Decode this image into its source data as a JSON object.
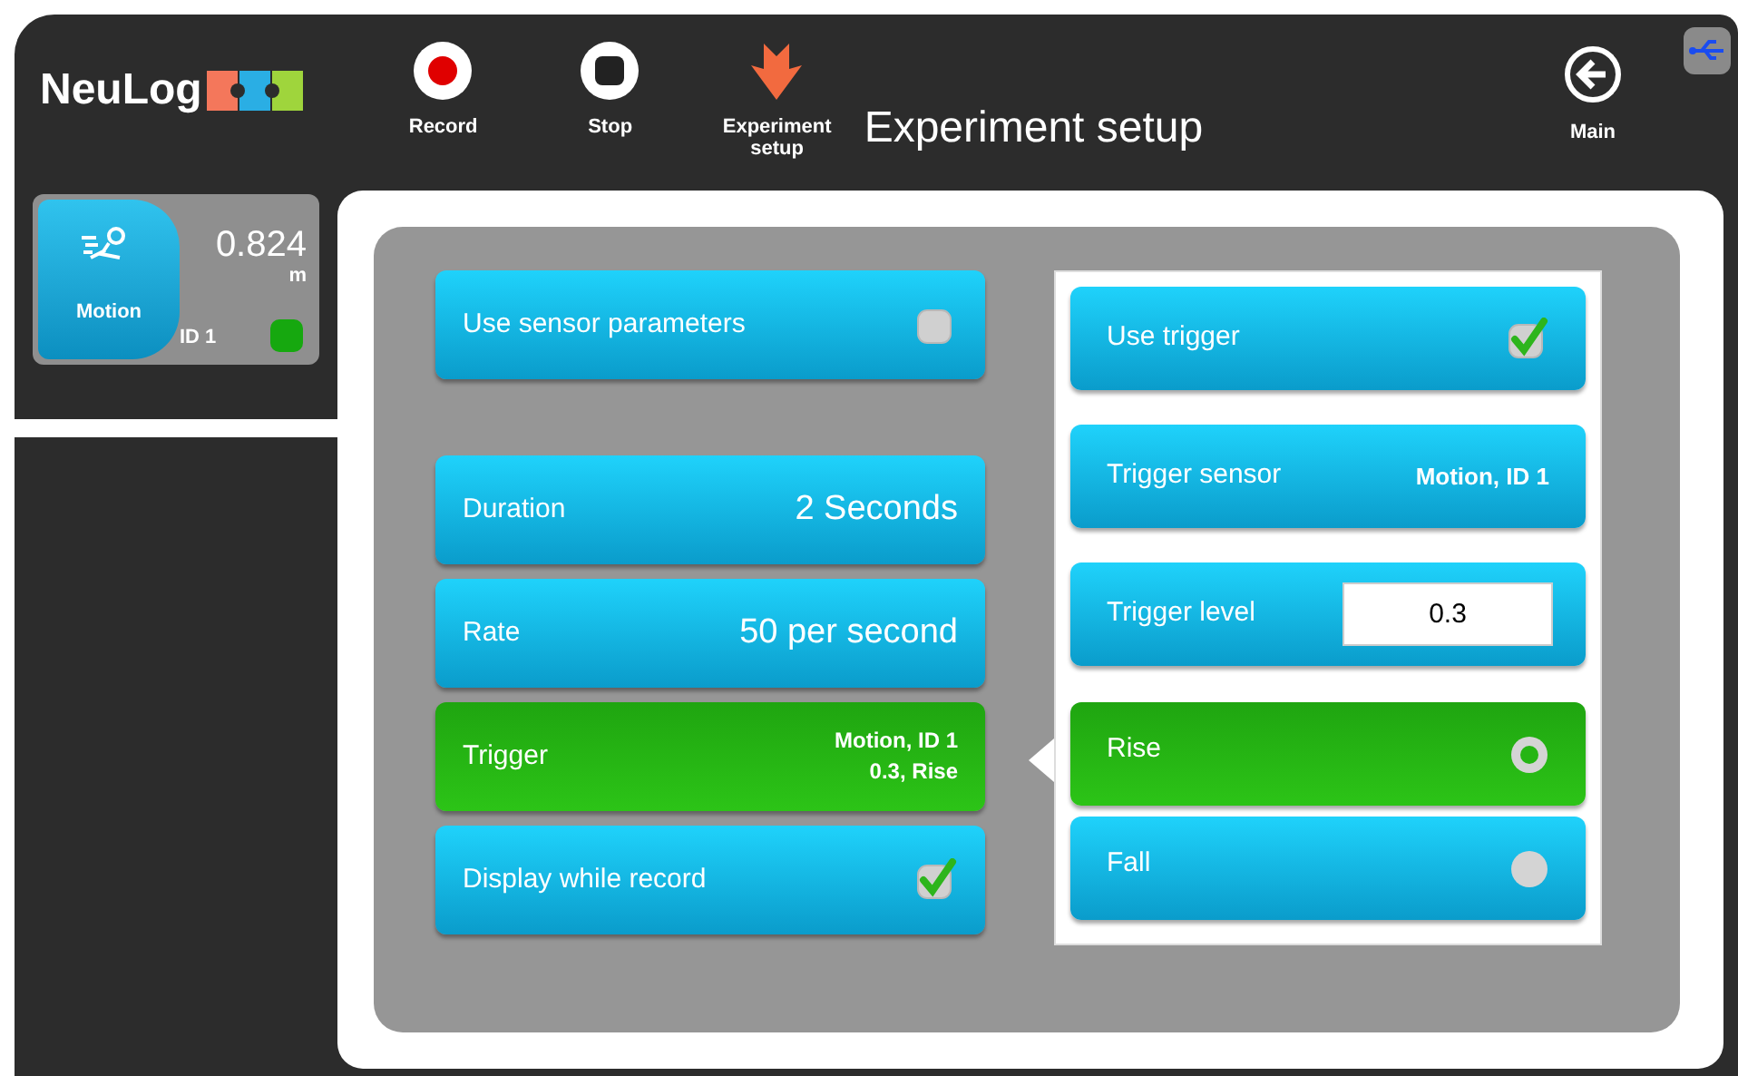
{
  "header": {
    "logo": "NeuLog",
    "tools": [
      {
        "kind": "record",
        "label": "Record"
      },
      {
        "kind": "stop",
        "label": "Stop"
      },
      {
        "kind": "setup",
        "label": "Experiment setup"
      }
    ],
    "title": "Experiment setup",
    "main": "Main"
  },
  "sensor": {
    "name": "Motion",
    "value": "0.824",
    "unit": "m",
    "id": "ID 1",
    "on": true
  },
  "sensor_parameters": {
    "label": "Use sensor parameters",
    "checked": false
  },
  "settings": [
    {
      "kind": "value",
      "label": "Duration",
      "value": "2 Seconds",
      "selected": false
    },
    {
      "kind": "value",
      "label": "Rate",
      "value": "50 per second",
      "selected": false
    },
    {
      "kind": "lines",
      "label": "Trigger",
      "lines": [
        "Motion, ID 1",
        "0.3, Rise"
      ],
      "selected": true
    },
    {
      "kind": "checkbox",
      "label": "Display while record",
      "checked": true,
      "selected": false
    }
  ],
  "trigger": [
    {
      "kind": "checkbox",
      "label": "Use trigger",
      "checked": true
    },
    {
      "kind": "value",
      "label": "Trigger sensor",
      "value": "Motion, ID 1"
    },
    {
      "kind": "input",
      "label": "Trigger level",
      "value": "0.3"
    },
    {
      "kind": "radio",
      "label": "Rise",
      "selected": true
    },
    {
      "kind": "radio",
      "label": "Fall",
      "selected": false
    }
  ]
}
